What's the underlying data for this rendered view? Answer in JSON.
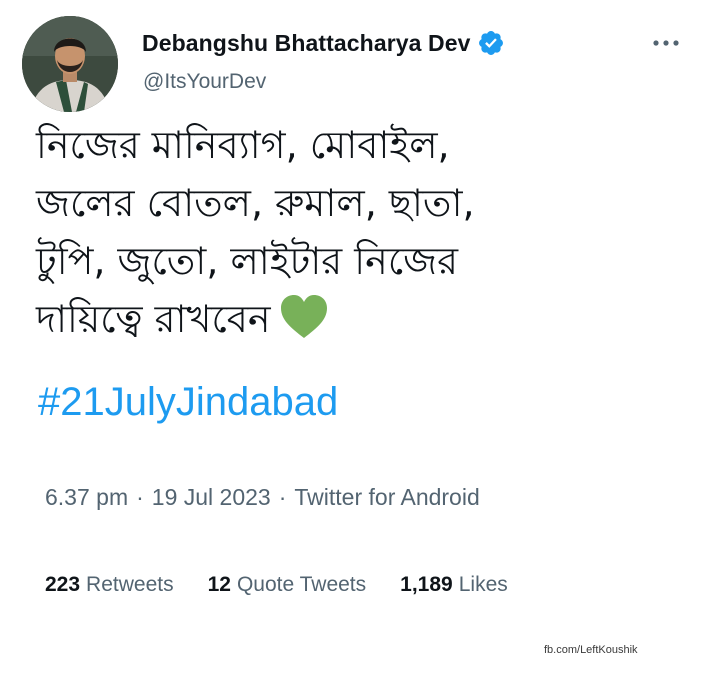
{
  "author": {
    "display_name": "Debangshu Bhattacharya Dev",
    "handle": "@ItsYourDev",
    "avatar_icon": "avatar-photo",
    "verified_icon": "verified-badge-icon"
  },
  "tweet": {
    "text_lines": [
      "নিজের মানিব্যাগ, মোবাইল,",
      "জলের বোতল, রুমাল, ছাতা,",
      "টুপি, জুতো, লাইটার নিজের",
      "দায়িত্বে রাখবেন"
    ],
    "emoji": "green-heart-icon",
    "hashtag": "#21JulyJindabad"
  },
  "meta": {
    "time": "6.37 pm",
    "date": "19 Jul 2023",
    "source": "Twitter for Android",
    "separator": "·"
  },
  "stats": {
    "retweets_count": "223",
    "retweets_label": "Retweets",
    "quotes_count": "12",
    "quotes_label": "Quote Tweets",
    "likes_count": "1,189",
    "likes_label": "Likes"
  },
  "watermark": "fb.com/LeftKoushik",
  "colors": {
    "link": "#1d9bf0",
    "secondary_text": "#536471",
    "primary_text": "#0f1419",
    "heart": "#78b159"
  }
}
